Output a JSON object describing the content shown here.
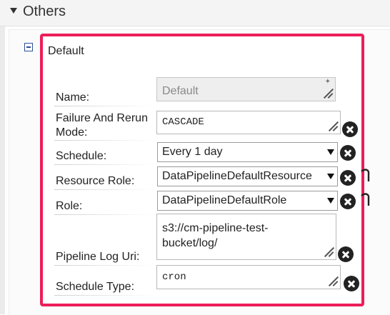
{
  "section": {
    "title": "Others"
  },
  "object": {
    "name": "Default"
  },
  "fields": {
    "name": {
      "label": "Name:",
      "value": "Default"
    },
    "failure_rerun": {
      "label_line1": "Failure And Rerun",
      "label_line2": "Mode:",
      "value": "CASCADE"
    },
    "schedule": {
      "label": "Schedule:",
      "value": "Every 1 day"
    },
    "resource_role": {
      "label": "Resource Role:",
      "value": "DataPipelineDefaultResource"
    },
    "role": {
      "label": "Role:",
      "value": "DataPipelineDefaultRole"
    },
    "pipeline_log_uri": {
      "label": "Pipeline Log Uri:",
      "value_line1": "s3://cm-pipeline-test-",
      "value_line2": "bucket/log/"
    },
    "schedule_type": {
      "label": "Schedule Type:",
      "value": "cron"
    }
  },
  "colors": {
    "highlight": "#ed1d5a",
    "toggle": "#2c4f96"
  }
}
